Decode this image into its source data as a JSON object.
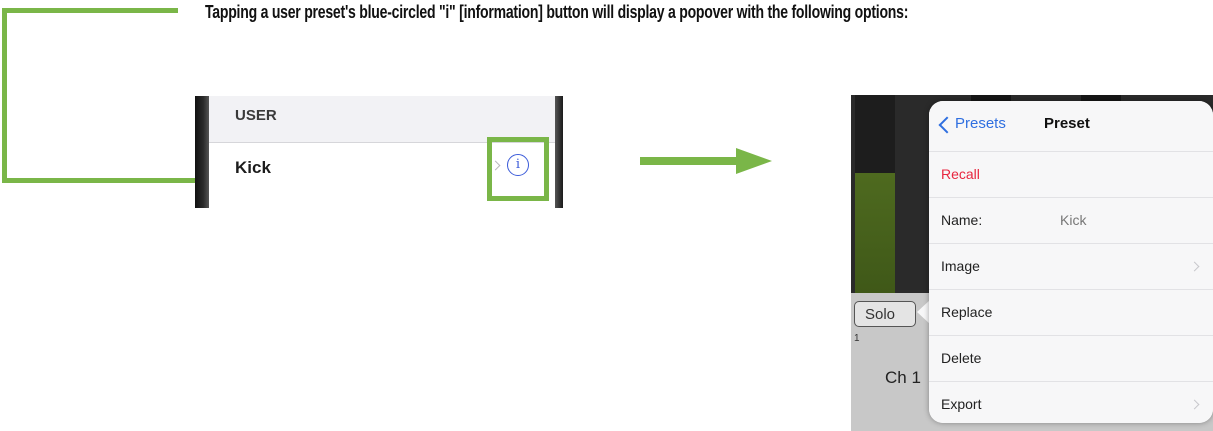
{
  "caption": "Tapping a user preset's blue-circled \"i\" [information] button will display a popover with the following options:",
  "colors": {
    "callout": "#7ab648",
    "info_blue": "#3b5bd9",
    "link_blue": "#2f6fe0",
    "destructive_red": "#e8263f"
  },
  "preset_list": {
    "section_header": "USER",
    "row_label": "Kick",
    "chevron_icon": "chevron-right-icon",
    "info_icon": "info-icon",
    "info_glyph": "i"
  },
  "mixer": {
    "solo_label": "Solo",
    "channel_label": "Ch 1",
    "channel_number": "1"
  },
  "popover": {
    "back_label": "Presets",
    "title": "Preset",
    "rows": [
      {
        "label": "Recall"
      },
      {
        "label": "Name:",
        "value": "Kick"
      },
      {
        "label": "Image"
      },
      {
        "label": "Replace"
      },
      {
        "label": "Delete"
      },
      {
        "label": "Export"
      }
    ]
  }
}
